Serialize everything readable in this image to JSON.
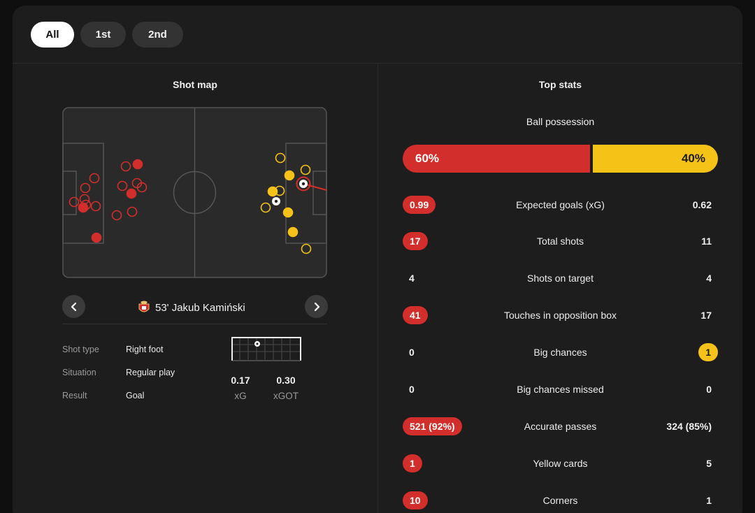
{
  "tabs": [
    {
      "label": "All",
      "active": true
    },
    {
      "label": "1st",
      "active": false
    },
    {
      "label": "2nd",
      "active": false
    }
  ],
  "shot_map": {
    "title": "Shot map",
    "selected": {
      "minute_player": "53' Jakub Kamiński",
      "details": [
        {
          "label": "Shot type",
          "value": "Right foot"
        },
        {
          "label": "Situation",
          "value": "Regular play"
        },
        {
          "label": "Result",
          "value": "Goal"
        }
      ],
      "xg": {
        "value": "0.17",
        "label": "xG"
      },
      "xgot": {
        "value": "0.30",
        "label": "xGOT"
      }
    }
  },
  "top_stats": {
    "title": "Top stats",
    "possession": {
      "label": "Ball possession",
      "home": "60%",
      "away": "40%",
      "home_fraction": 0.6
    },
    "rows": [
      {
        "name": "Expected goals (xG)",
        "home": "0.99",
        "away": "0.62",
        "highlight": "home"
      },
      {
        "name": "Total shots",
        "home": "17",
        "away": "11",
        "highlight": "home"
      },
      {
        "name": "Shots on target",
        "home": "4",
        "away": "4",
        "highlight": "none"
      },
      {
        "name": "Touches in opposition box",
        "home": "41",
        "away": "17",
        "highlight": "home"
      },
      {
        "name": "Big chances",
        "home": "0",
        "away": "1",
        "highlight": "away"
      },
      {
        "name": "Big chances missed",
        "home": "0",
        "away": "0",
        "highlight": "none"
      },
      {
        "name": "Accurate passes",
        "home": "521 (92%)",
        "away": "324 (85%)",
        "highlight": "home"
      },
      {
        "name": "Yellow cards",
        "home": "1",
        "away": "5",
        "highlight": "home"
      },
      {
        "name": "Corners",
        "home": "10",
        "away": "1",
        "highlight": "home"
      }
    ]
  },
  "colors": {
    "home": "#d22e2b",
    "away": "#f5c218",
    "card": "#1d1d1d"
  },
  "icons": {
    "prev": "chevron-left-icon",
    "next": "chevron-right-icon",
    "team_crest": "benfica-crest-icon",
    "goal": "ball-icon"
  }
}
